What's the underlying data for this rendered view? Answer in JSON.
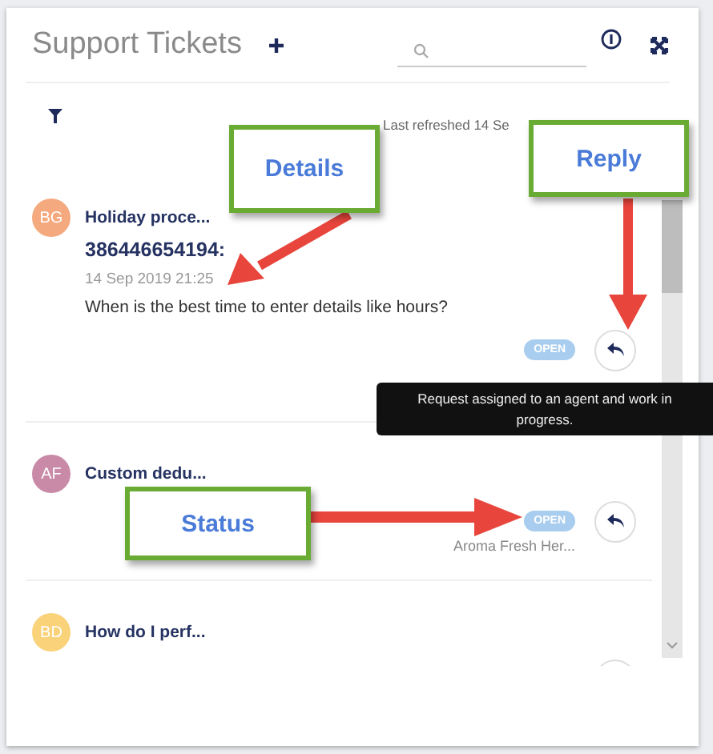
{
  "header": {
    "title": "Support Tickets"
  },
  "last_refreshed": "Last refreshed 14 Se",
  "tickets": [
    {
      "initials": "BG",
      "color": "#f5a97f",
      "title": "Holiday proce...",
      "number": "386446654194:",
      "date": "14 Sep 2019 21:25",
      "question": "When is the best time to enter details like hours?",
      "status": "OPEN",
      "tooltip": [
        "Request assigned to an agent and work in",
        "progress."
      ]
    },
    {
      "initials": "AF",
      "color": "#c88aa6",
      "title": "Custom dedu...",
      "status": "OPEN",
      "company": "Aroma Fresh Her..."
    },
    {
      "initials": "BD",
      "color": "#f9d27a",
      "title": "How do I perf..."
    }
  ],
  "callouts": [
    {
      "label": "Details",
      "kind": "details"
    },
    {
      "label": "Reply",
      "kind": "reply"
    },
    {
      "label": "Status",
      "kind": "status"
    }
  ]
}
